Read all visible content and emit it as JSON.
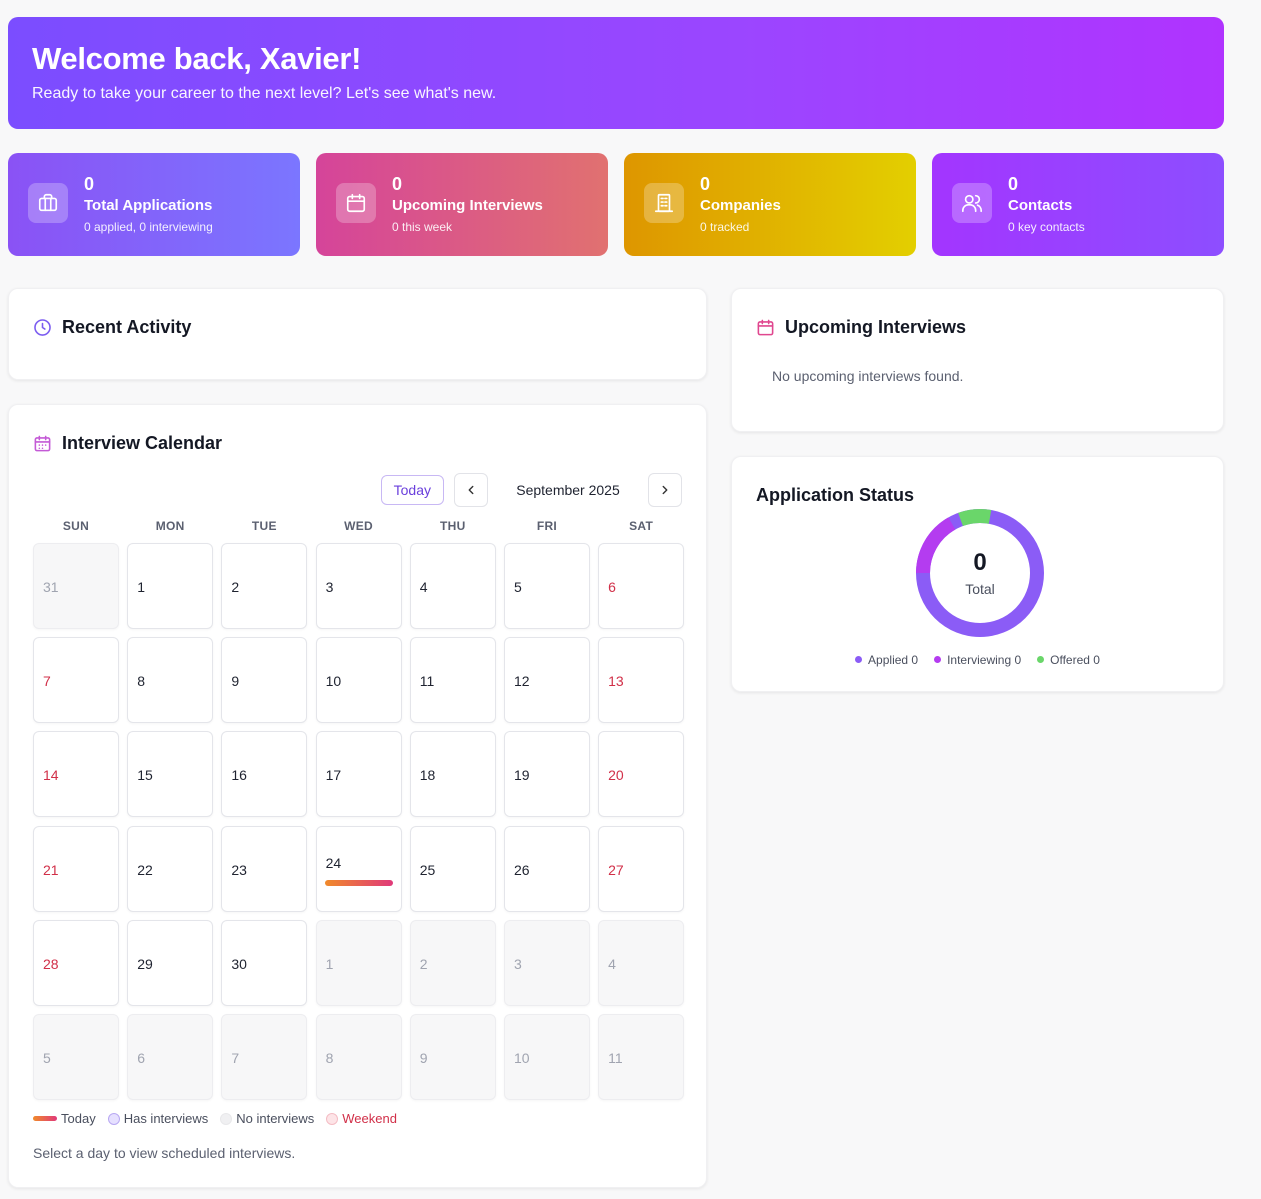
{
  "hero": {
    "title": "Welcome back, Xavier!",
    "subtitle": "Ready to take your career to the next level? Let's see what's new."
  },
  "stats": [
    {
      "value": "0",
      "label": "Total Applications",
      "sub": "0 applied, 0 interviewing",
      "icon": "briefcase-icon"
    },
    {
      "value": "0",
      "label": "Upcoming Interviews",
      "sub": "0 this week",
      "icon": "calendar-icon"
    },
    {
      "value": "0",
      "label": "Companies",
      "sub": "0 tracked",
      "icon": "building-icon"
    },
    {
      "value": "0",
      "label": "Contacts",
      "sub": "0 key contacts",
      "icon": "users-icon"
    }
  ],
  "recent_activity": {
    "title": "Recent Activity"
  },
  "upcoming_interviews": {
    "title": "Upcoming Interviews",
    "empty": "No upcoming interviews found."
  },
  "application_status": {
    "title": "Application Status",
    "total": "0",
    "total_label": "Total",
    "legend": [
      {
        "label": "Applied 0",
        "color": "#8b5cf6"
      },
      {
        "label": "Interviewing 0",
        "color": "#b43cf0"
      },
      {
        "label": "Offered 0",
        "color": "#6ad66a"
      }
    ]
  },
  "calendar": {
    "title": "Interview Calendar",
    "today_label": "Today",
    "month": "September 2025",
    "weekdays": [
      "SUN",
      "MON",
      "TUE",
      "WED",
      "THU",
      "FRI",
      "SAT"
    ],
    "days": [
      {
        "d": "31",
        "other": true
      },
      {
        "d": "1"
      },
      {
        "d": "2"
      },
      {
        "d": "3"
      },
      {
        "d": "4"
      },
      {
        "d": "5"
      },
      {
        "d": "6",
        "wk": true
      },
      {
        "d": "7",
        "wk": true
      },
      {
        "d": "8"
      },
      {
        "d": "9"
      },
      {
        "d": "10"
      },
      {
        "d": "11"
      },
      {
        "d": "12"
      },
      {
        "d": "13",
        "wk": true
      },
      {
        "d": "14",
        "wk": true
      },
      {
        "d": "15"
      },
      {
        "d": "16"
      },
      {
        "d": "17"
      },
      {
        "d": "18"
      },
      {
        "d": "19"
      },
      {
        "d": "20",
        "wk": true
      },
      {
        "d": "21",
        "wk": true
      },
      {
        "d": "22"
      },
      {
        "d": "23"
      },
      {
        "d": "24",
        "today": true
      },
      {
        "d": "25"
      },
      {
        "d": "26"
      },
      {
        "d": "27",
        "wk": true
      },
      {
        "d": "28",
        "wk": true
      },
      {
        "d": "29"
      },
      {
        "d": "30"
      },
      {
        "d": "1",
        "other": true
      },
      {
        "d": "2",
        "other": true
      },
      {
        "d": "3",
        "other": true
      },
      {
        "d": "4",
        "other": true
      },
      {
        "d": "5",
        "other": true
      },
      {
        "d": "6",
        "other": true
      },
      {
        "d": "7",
        "other": true
      },
      {
        "d": "8",
        "other": true
      },
      {
        "d": "9",
        "other": true
      },
      {
        "d": "10",
        "other": true
      },
      {
        "d": "11",
        "other": true
      }
    ],
    "legend": {
      "today": "Today",
      "has": "Has interviews",
      "none": "No interviews",
      "weekend": "Weekend"
    },
    "hint": "Select a day to view scheduled interviews."
  }
}
